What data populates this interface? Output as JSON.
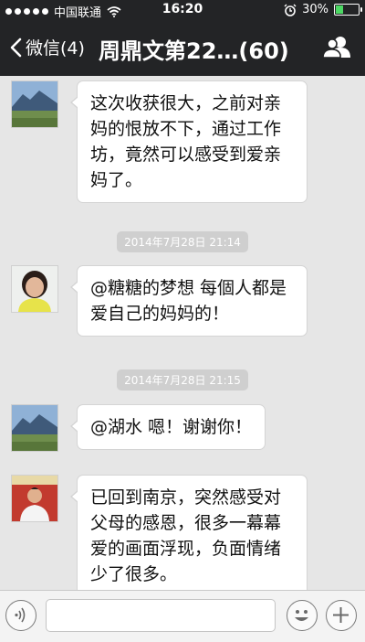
{
  "status_bar": {
    "carrier": "中国联通",
    "time": "16:20",
    "battery": "30%",
    "battery_level": 0.3
  },
  "nav": {
    "back_label": "微信(4)",
    "title": "周鼎文第22…(60)"
  },
  "messages": [
    {
      "avatar": "mountain-avatar",
      "text": "这次收获很大，之前对亲妈的恨放不下，通过工作坊，竟然可以感受到爱亲妈了。"
    },
    {
      "timestamp": "2014年7月28日 21:14"
    },
    {
      "avatar": "woman-avatar",
      "text": "@糖糖的梦想 每個人都是爱自己的妈妈的！"
    },
    {
      "timestamp": "2014年7月28日 21:15"
    },
    {
      "avatar": "mountain-avatar",
      "text": "@湖水 嗯！谢谢你！"
    },
    {
      "avatar": "man-avatar",
      "text": "已回到南京，突然感受对父母的感恩，很多一幕幕爱的画面浮现，负面情绪少了很多。"
    }
  ],
  "colors": {
    "nav_background": "#232426",
    "chat_background": "#e6e6e6",
    "battery_fill": "#4cd964"
  },
  "icons": [
    "signal-dots-icon",
    "wifi-icon",
    "alarm-icon",
    "battery-icon",
    "back-chevron-icon",
    "group-members-icon",
    "voice-icon",
    "emoji-icon",
    "plus-icon"
  ]
}
